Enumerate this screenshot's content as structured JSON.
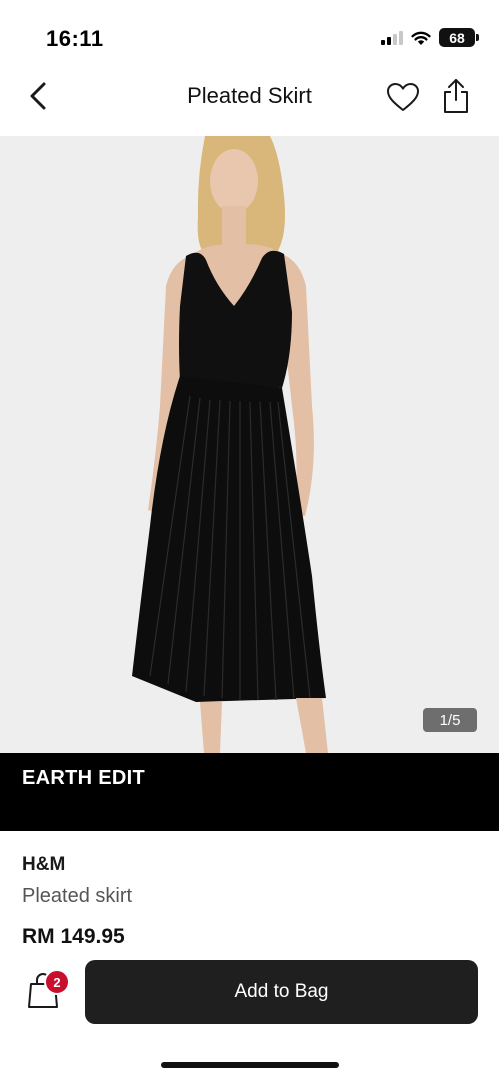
{
  "status_bar": {
    "time": "16:11",
    "battery": "68",
    "icons": [
      "signal-icon",
      "wifi-icon",
      "battery-icon"
    ]
  },
  "nav": {
    "title": "Pleated Skirt",
    "icons": [
      "back-chevron-icon",
      "heart-icon",
      "share-icon"
    ]
  },
  "gallery": {
    "indicator": "1/5",
    "current_image": 1,
    "total_images": 5
  },
  "banner": {
    "text": "EARTH EDIT"
  },
  "product": {
    "brand": "H&M",
    "name": "Pleated skirt",
    "price": "RM 149.95"
  },
  "actions": {
    "bag_count": "2",
    "add_to_bag_label": "Add to Bag"
  },
  "colors": {
    "button": "#1f1f1f",
    "badge": "#c8102e",
    "banner": "#000000",
    "image_background": "#efeeef"
  }
}
